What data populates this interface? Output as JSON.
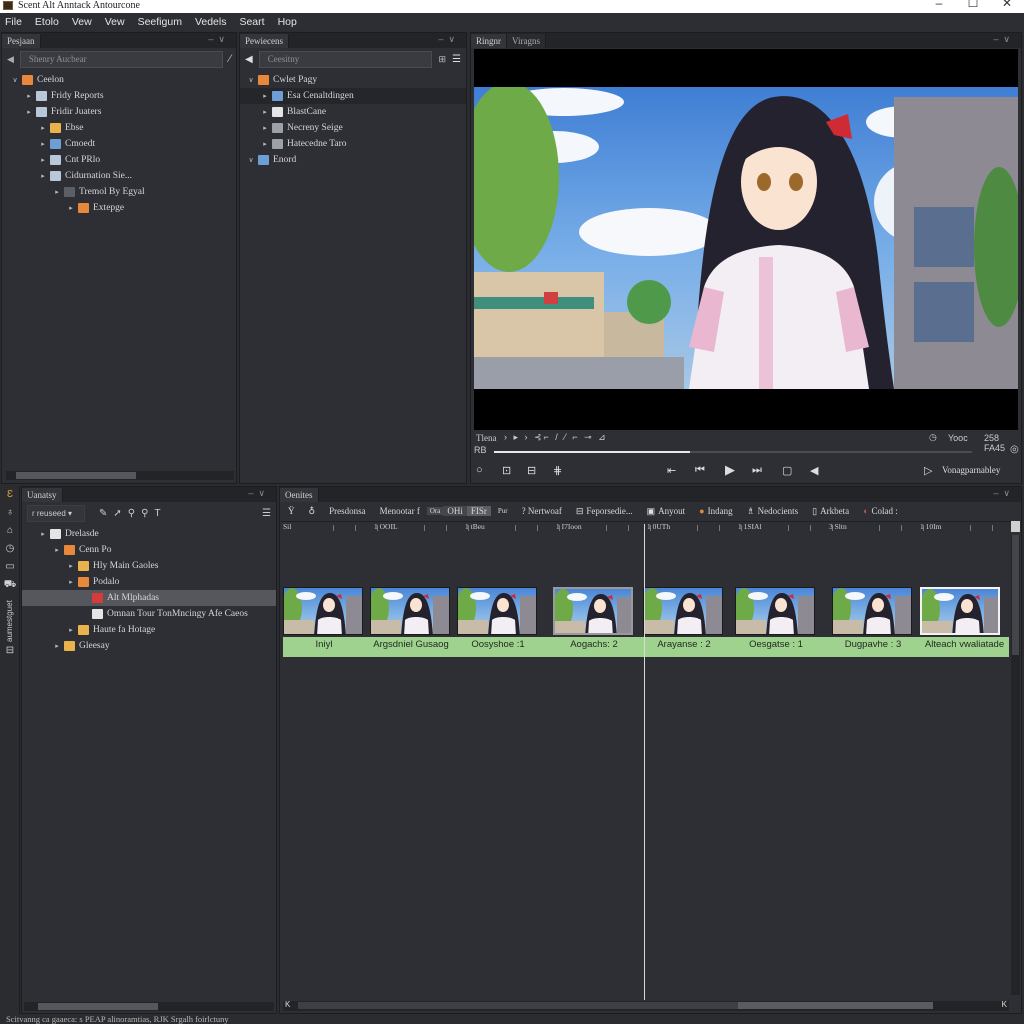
{
  "window": {
    "title": "Scent Alt Anntack Antourcone",
    "controls": [
      "minimize",
      "maximize",
      "close"
    ]
  },
  "menubar": [
    "File",
    "Etolo",
    "Vew",
    "Vew",
    "Seefigum",
    "Vedels",
    "Seart",
    "Hop"
  ],
  "left_panel": {
    "tab": "Pesjaan",
    "search_placeholder": "Shenry Aucbear",
    "tree": [
      {
        "label": "Ceelon",
        "depth": 0,
        "expanded": true,
        "icon": "orange"
      },
      {
        "label": "Fridy Reports",
        "depth": 1,
        "icon": "doc"
      },
      {
        "label": "Fridir Juaters",
        "depth": 1,
        "icon": "doc"
      },
      {
        "label": "Ebse",
        "depth": 2,
        "icon": "folder"
      },
      {
        "label": "Cmoedt",
        "depth": 2,
        "icon": "blue"
      },
      {
        "label": "Cnt PRlo",
        "depth": 2,
        "icon": "doc"
      },
      {
        "label": "Cidurnation Sie...",
        "depth": 2,
        "icon": "doc"
      },
      {
        "label": "Tremol By Egyal",
        "depth": 3,
        "icon": "dark"
      },
      {
        "label": "Extepge",
        "depth": 4,
        "icon": "orange"
      }
    ]
  },
  "middle_panel": {
    "tab": "Pewiecens",
    "search_placeholder": "Ceesitny",
    "tree": [
      {
        "label": "Cwlet Pagy",
        "depth": 0,
        "expanded": true,
        "icon": "orange"
      },
      {
        "label": "Esa Cenaltdingen",
        "depth": 1,
        "icon": "blue",
        "highlight": true
      },
      {
        "label": "BlastCane",
        "depth": 1,
        "icon": "white"
      },
      {
        "label": "Necreny Seige",
        "depth": 1,
        "icon": "gray"
      },
      {
        "label": "Hatecedne Taro",
        "depth": 1,
        "icon": "gray"
      },
      {
        "label": "Enord",
        "depth": 0,
        "expanded": true,
        "icon": "blue"
      }
    ]
  },
  "viewer": {
    "tabs": [
      "Ringnr",
      "Viragns"
    ],
    "controls_row_label": "Tlena",
    "timecode_label": "Yooc",
    "timecode_value": "258 FA45",
    "progress_label": "RB",
    "progress": 0.41,
    "mode_label": "Vonagparnabley",
    "transport": [
      "go-start",
      "step-back",
      "play",
      "step-forward",
      "loop",
      "audio"
    ]
  },
  "media_panel": {
    "tab": "Uanatsy",
    "dropdown": "r reuseed",
    "tree": [
      {
        "label": "Drelasde",
        "depth": 1,
        "icon": "white"
      },
      {
        "label": "Cenn Po",
        "depth": 2,
        "icon": "orange"
      },
      {
        "label": "Hly Main Gaoles",
        "depth": 3,
        "icon": "folder"
      },
      {
        "label": "Podalo",
        "depth": 3,
        "icon": "orange"
      },
      {
        "label": "Alt Mlphadas",
        "depth": 4,
        "icon": "red",
        "selected": true
      },
      {
        "label": "Omnan Tour TonMncingy Afe Caeos",
        "depth": 4,
        "icon": "white"
      },
      {
        "label": "Haute fa Hotage",
        "depth": 3,
        "icon": "folder"
      },
      {
        "label": "Gleesay",
        "depth": 2,
        "icon": "folder"
      }
    ],
    "rail_label": "aumestguet"
  },
  "timeline": {
    "tab": "Oenites",
    "toolbar": [
      "Presdonsa",
      "Menootar f",
      "Ora",
      "OHi",
      "FISr",
      "Pur",
      "? Nertwoaf",
      "Feporsedie...",
      "Anyout",
      "Indang",
      "Nedocients",
      "Arkbeta",
      "Colad :"
    ],
    "ruler_ticks": [
      "Sil",
      "1 OOIL",
      "1 tBeu",
      "1 I7Ioon",
      "1 0UTh",
      "1 1SIAl",
      "3 Sltn",
      "1 10Im"
    ],
    "clips": [
      {
        "label": "Iniyl",
        "state": "normal"
      },
      {
        "label": "Argsdniel Gusaog",
        "state": "normal"
      },
      {
        "label": "Oosyshoe :1",
        "state": "normal"
      },
      {
        "label": "Aogachs: 2",
        "state": "selected"
      },
      {
        "label": "Arayanse : 2",
        "state": "normal"
      },
      {
        "label": "Oesgatse : 1",
        "state": "normal"
      },
      {
        "label": "Dugpavhe : 3",
        "state": "normal"
      },
      {
        "label": "Alteach vwaliatade",
        "state": "highlight"
      }
    ],
    "playhead_position": 0.5
  },
  "statusbar": "Scitvanng ca gaaeca: s PEAP alinoramtias, RJK Srgalh foirlctuny",
  "colors": {
    "panel_bg": "#2e2f34",
    "clip_label_track": "#9fd18f",
    "accent_red": "#d63a3a",
    "folder": "#e9b24a"
  }
}
